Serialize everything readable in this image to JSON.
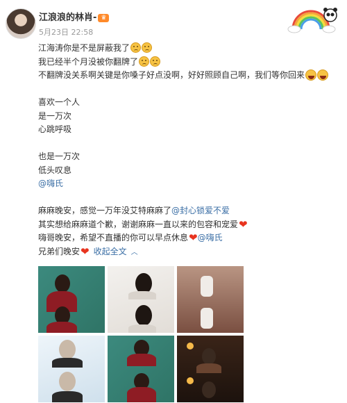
{
  "post": {
    "author": "江浪浪的林肖-",
    "time": "5月23日 22:58"
  },
  "content": {
    "lines": [
      "江海涛你是不是屏蔽我了",
      "我已经半个月没被你翻牌了",
      "不翻牌没关系啊关键是你嗓子好点没啊，好好照顾自己啊，我们等你回来",
      "喜欢一个人",
      "是一万次",
      "心跳呼吸",
      "也是一万次",
      "低头叹息",
      "@嗨氏",
      "麻麻晚安，感觉一万年没艾特麻麻了",
      "@封心锁爱不爱",
      "其实想给麻麻道个歉，谢谢麻麻一直以来的包容和宠爱",
      "嗨哥晚安，希望不直播的你可以早点休息",
      "@嗨氏",
      "兄弟们晚安"
    ],
    "collapse_label": "收起全文"
  },
  "icons": {
    "vip": "vip-badge-icon",
    "sad": "sad-face-emoji",
    "laugh": "laughing-face-emoji",
    "heart": "red-heart-emoji",
    "collapse": "chevron-up-icon",
    "decoration": "rainbow-sticker-icon"
  },
  "colors": {
    "link": "#3a6ea5",
    "time": "#999999",
    "heart": "#e8341f"
  }
}
